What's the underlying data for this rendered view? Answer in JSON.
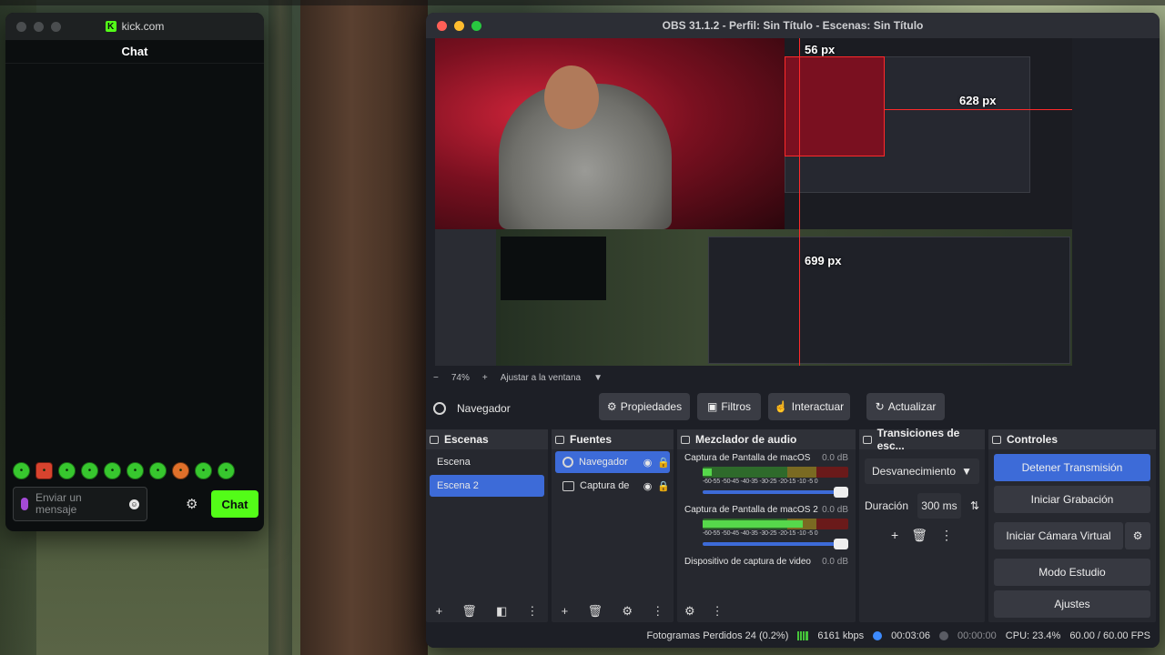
{
  "kick": {
    "url": "kick.com",
    "header": "Chat",
    "input_placeholder": "Enviar un mensaje",
    "chat_button": "Chat"
  },
  "obs": {
    "title": "OBS 31.1.2 - Perfil: Sin Título - Escenas: Sin Título",
    "preview": {
      "label_56": "56 px",
      "label_628": "628 px",
      "label_699": "699 px"
    },
    "zoom": {
      "minus": "−",
      "level": "74%",
      "plus": "+",
      "fit": "Ajustar a la ventana"
    },
    "source_toolbar": {
      "source": "Navegador",
      "properties": "Propiedades",
      "filters": "Filtros",
      "interact": "Interactuar",
      "refresh": "Actualizar"
    },
    "scenes": {
      "title": "Escenas",
      "items": [
        "Escena",
        "Escena 2"
      ]
    },
    "sources": {
      "title": "Fuentes",
      "items": [
        "Navegador",
        "Captura de"
      ]
    },
    "mixer": {
      "title": "Mezclador de audio",
      "tracks": [
        {
          "name": "Captura de Pantalla de macOS",
          "db": "0.0 dB",
          "level": 0.06
        },
        {
          "name": "Captura de Pantalla de macOS 2",
          "db": "0.0 dB",
          "level": 0.69
        },
        {
          "name": "Dispositivo de captura de video",
          "db": "0.0 dB"
        }
      ],
      "scale": "-60-55 -50-45 -40-35 -30-25 -20-15 -10 -5 0"
    },
    "transitions": {
      "title": "Transiciones de esc...",
      "selected": "Desvanecimiento",
      "duration_label": "Duración",
      "duration_value": "300 ms"
    },
    "controls": {
      "title": "Controles",
      "stop_stream": "Detener Transmisión",
      "start_record": "Iniciar Grabación",
      "virtual_cam": "Iniciar Cámara Virtual",
      "studio_mode": "Modo Estudio",
      "settings": "Ajustes"
    },
    "status": {
      "dropped": "Fotogramas Perdidos 24 (0.2%)",
      "bitrate": "6161 kbps",
      "stream_time": "00:03:06",
      "record_time": "00:00:00",
      "cpu": "CPU: 23.4%",
      "fps": "60.00 / 60.00 FPS"
    }
  },
  "colors": {
    "kick_green": "#53fc18",
    "obs_accent": "#3d6bd8",
    "guide_red": "#ff2a2a"
  }
}
